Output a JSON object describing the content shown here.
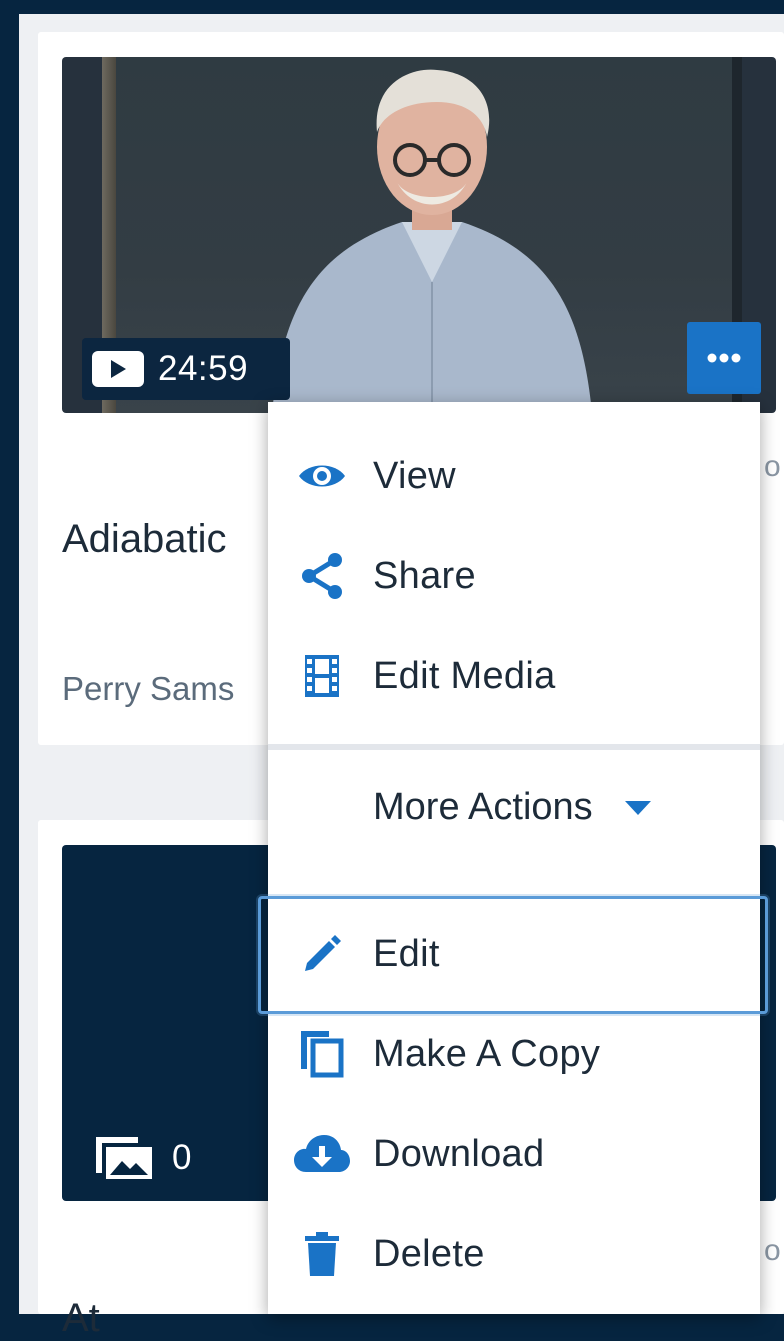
{
  "colors": {
    "accent": "#1a73c6",
    "background": "#062540",
    "text": "#1d2b39",
    "muted": "#5b6b7b"
  },
  "cards": [
    {
      "duration": "24:59",
      "title": "Adiabatic",
      "author": "Perry Sams",
      "more_icon": "ellipsis-icon"
    },
    {
      "image_count": "0",
      "title": "At"
    }
  ],
  "menu": {
    "items": [
      {
        "label": "View",
        "icon": "eye-icon"
      },
      {
        "label": "Share",
        "icon": "share-icon"
      },
      {
        "label": "Edit Media",
        "icon": "film-icon"
      }
    ],
    "more_actions_label": "More Actions",
    "actions": [
      {
        "label": "Edit",
        "icon": "pencil-icon"
      },
      {
        "label": "Make A Copy",
        "icon": "copy-icon"
      },
      {
        "label": "Download",
        "icon": "cloud-download-icon"
      },
      {
        "label": "Delete",
        "icon": "trash-icon"
      }
    ]
  }
}
